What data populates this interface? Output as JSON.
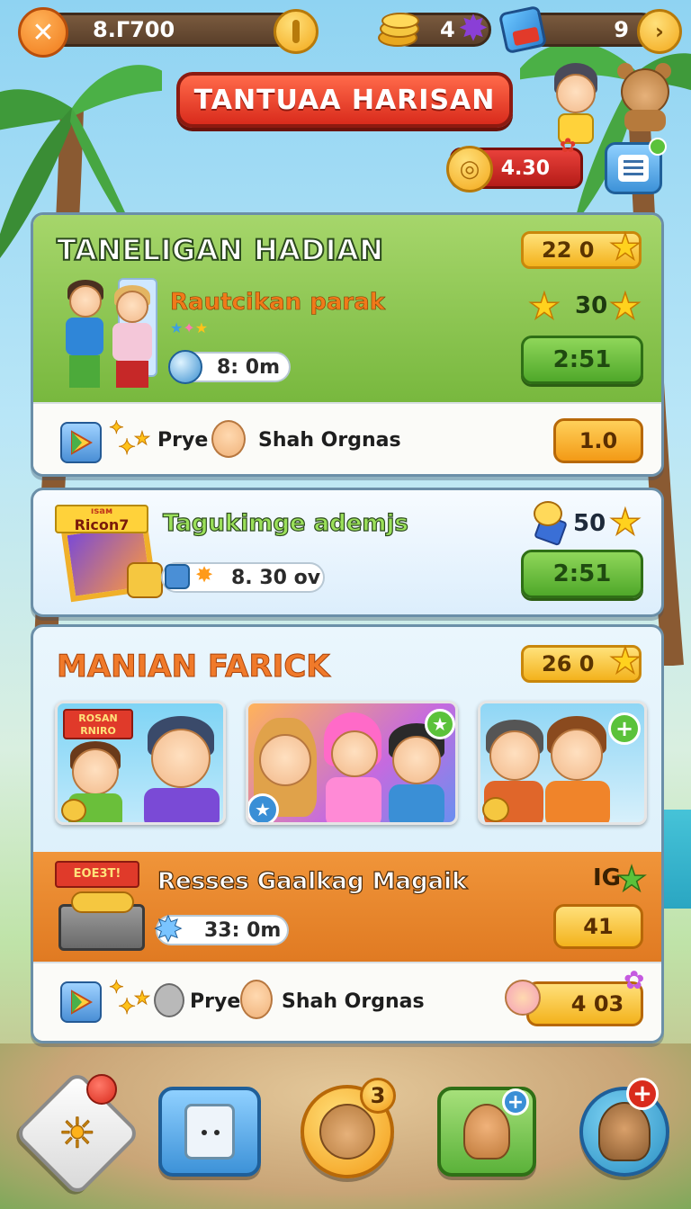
{
  "topbar": {
    "left_value": "8.Г700",
    "coins_value": "4",
    "gems_value": "9"
  },
  "title": "TANTUAA HARISAN",
  "currency": {
    "coin_value": "4.30"
  },
  "panel1": {
    "title": "TANELIGAN HADIAN",
    "badge_value": "22 0",
    "subtitle": "Rautcikan parak",
    "star_value": "30",
    "timer": "8: 0m",
    "action_value": "2:51",
    "footer": {
      "label_a": "Prye",
      "label_b": "Shah Orgnas",
      "button_value": "1.0"
    }
  },
  "panel2": {
    "ribbon": "Ricon7",
    "ribbon_small": "ısaм",
    "title": "Tagukimge ademjs",
    "star_value": "50",
    "timer": "8. 30  ov",
    "action_value": "2:51"
  },
  "panel3": {
    "title": "MANIAN FARICK",
    "badge_value": "26 0",
    "thumb1_ribbon": "ROSAN RNIRO",
    "chest": {
      "ribbon": "EOE3T!",
      "title": "Resses Gaalkag Magaik",
      "badge_text": "IG",
      "timer": "33: 0m",
      "button_value": "41"
    },
    "footer": {
      "label_a": "Prye",
      "label_b": "Shah Orgnas",
      "button_value": "4 03"
    }
  },
  "bottom_nav": {
    "home_badge": "",
    "profile_badge": "3"
  },
  "colors": {
    "accent_red": "#d92b1c",
    "accent_green": "#4fa82a",
    "accent_gold": "#f3b21c",
    "panel_header_green": "#78b83e",
    "chest_orange": "#e7872e"
  },
  "icons": [
    "back-arrow-icon",
    "coin-icon",
    "gem-icon",
    "dice-icon",
    "list-icon",
    "star-icon",
    "play-store-icon",
    "sparkle-icon",
    "timer-icon",
    "plus-icon",
    "sun-icon",
    "card-icon",
    "bear-icon",
    "squirrel-icon",
    "beaver-icon"
  ]
}
